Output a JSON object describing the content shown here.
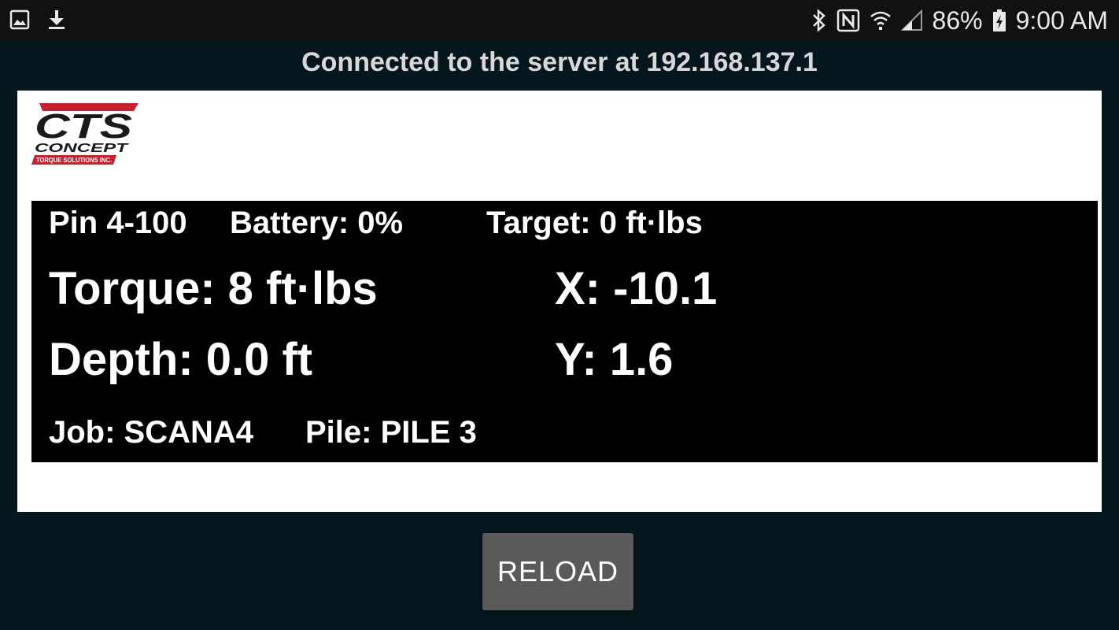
{
  "status_bar": {
    "left_icons": [
      "image-icon",
      "download-icon"
    ],
    "right_icons": [
      "bluetooth-icon",
      "nfc-icon",
      "wifi-icon",
      "cell-signal-icon"
    ],
    "battery_percent": "86%",
    "battery_icon": "battery-charging-icon",
    "time": "9:00 AM"
  },
  "connection": {
    "message": "Connected to the server at 192.168.137.1"
  },
  "logo": {
    "mark": "CTS",
    "name": "CONCEPT",
    "tagline": "TORQUE SOLUTIONS INC.",
    "colors": {
      "red": "#c8202f",
      "dark": "#1a1a1a"
    }
  },
  "readout": {
    "pin": "Pin 4-100",
    "battery": "Battery: 0%",
    "target": "Target: 0 ft·lbs",
    "torque": "Torque: 8 ft·lbs",
    "x": "X: -10.1",
    "depth": "Depth: 0.0 ft",
    "y": "Y: 1.6",
    "job": "Job: SCANA4",
    "pile": "Pile: PILE 3"
  },
  "actions": {
    "reload_label": "RELOAD"
  }
}
